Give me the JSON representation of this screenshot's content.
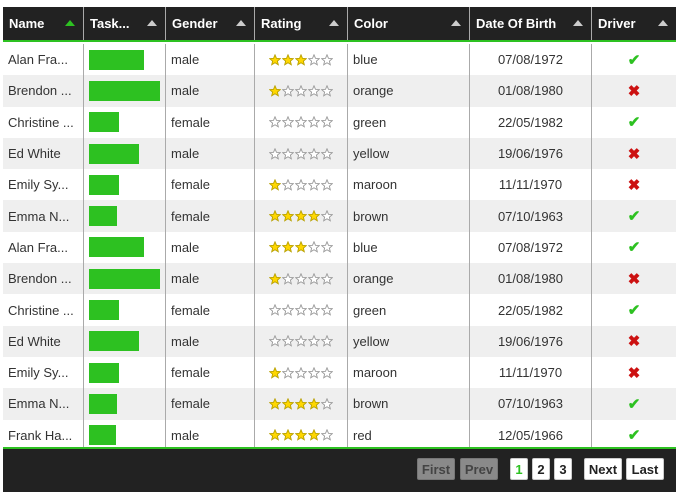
{
  "columns": [
    {
      "key": "name",
      "label": "Name",
      "sorted": true
    },
    {
      "key": "progress",
      "label": "Task...",
      "sorted": false
    },
    {
      "key": "gender",
      "label": "Gender",
      "sorted": false
    },
    {
      "key": "rating",
      "label": "Rating",
      "sorted": false
    },
    {
      "key": "color",
      "label": "Color",
      "sorted": false
    },
    {
      "key": "dob",
      "label": "Date Of Birth",
      "sorted": false
    },
    {
      "key": "driver",
      "label": "Driver",
      "sorted": false
    }
  ],
  "rows": [
    {
      "name": "Alan Fra...",
      "progress": 0.78,
      "gender": "male",
      "rating": 3,
      "color": "blue",
      "dob": "07/08/1972",
      "driver": true
    },
    {
      "name": "Brendon ...",
      "progress": 1.0,
      "gender": "male",
      "rating": 1,
      "color": "orange",
      "dob": "01/08/1980",
      "driver": false
    },
    {
      "name": "Christine ...",
      "progress": 0.42,
      "gender": "female",
      "rating": 0,
      "color": "green",
      "dob": "22/05/1982",
      "driver": true
    },
    {
      "name": "Ed White",
      "progress": 0.7,
      "gender": "male",
      "rating": 0,
      "color": "yellow",
      "dob": "19/06/1976",
      "driver": false
    },
    {
      "name": "Emily Sy...",
      "progress": 0.42,
      "gender": "female",
      "rating": 1,
      "color": "maroon",
      "dob": "11/11/1970",
      "driver": false
    },
    {
      "name": "Emma N...",
      "progress": 0.4,
      "gender": "female",
      "rating": 4,
      "color": "brown",
      "dob": "07/10/1963",
      "driver": true
    },
    {
      "name": "Alan Fra...",
      "progress": 0.78,
      "gender": "male",
      "rating": 3,
      "color": "blue",
      "dob": "07/08/1972",
      "driver": true
    },
    {
      "name": "Brendon ...",
      "progress": 1.0,
      "gender": "male",
      "rating": 1,
      "color": "orange",
      "dob": "01/08/1980",
      "driver": false
    },
    {
      "name": "Christine ...",
      "progress": 0.42,
      "gender": "female",
      "rating": 0,
      "color": "green",
      "dob": "22/05/1982",
      "driver": true
    },
    {
      "name": "Ed White",
      "progress": 0.7,
      "gender": "male",
      "rating": 0,
      "color": "yellow",
      "dob": "19/06/1976",
      "driver": false
    },
    {
      "name": "Emily Sy...",
      "progress": 0.42,
      "gender": "female",
      "rating": 1,
      "color": "maroon",
      "dob": "11/11/1970",
      "driver": false
    },
    {
      "name": "Emma N...",
      "progress": 0.4,
      "gender": "female",
      "rating": 4,
      "color": "brown",
      "dob": "07/10/1963",
      "driver": true
    },
    {
      "name": "Frank Ha...",
      "progress": 0.38,
      "gender": "male",
      "rating": 4,
      "color": "red",
      "dob": "12/05/1966",
      "driver": true
    }
  ],
  "pagination": {
    "first": "First",
    "prev": "Prev",
    "pages": [
      "1",
      "2",
      "3"
    ],
    "current": "1",
    "next": "Next",
    "last": "Last"
  },
  "colors": {
    "header_bg": "#222222",
    "accent": "#2dc121",
    "star_on": "#ffd700",
    "cross": "#cc1111"
  }
}
